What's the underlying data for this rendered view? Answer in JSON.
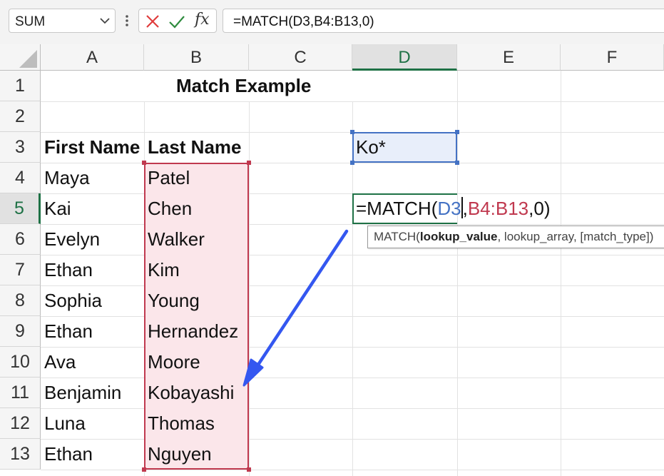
{
  "formula_bar": {
    "name_box": "SUM",
    "fx_label": "fx",
    "formula": "=MATCH(D3,B4:B13,0)"
  },
  "columns": [
    "A",
    "B",
    "C",
    "D",
    "E",
    "F"
  ],
  "rows": [
    "1",
    "2",
    "3",
    "4",
    "5",
    "6",
    "7",
    "8",
    "9",
    "10",
    "11",
    "12",
    "13"
  ],
  "cells": {
    "title": "Match Example",
    "a3": "First Name",
    "b3": "Last Name",
    "d3": "Ko*",
    "first_names": [
      "Maya",
      "Kai",
      "Evelyn",
      "Ethan",
      "Sophia",
      "Ethan",
      "Ava",
      "Benjamin",
      "Luna",
      "Ethan"
    ],
    "last_names": [
      "Patel",
      "Chen",
      "Walker",
      "Kim",
      "Young",
      "Hernandez",
      "Moore",
      "Kobayashi",
      "Thomas",
      "Nguyen"
    ]
  },
  "edit": {
    "prefix": "=MATCH(",
    "arg1": "D3",
    "sep1": ",",
    "arg2": "B4:B13",
    "rest": ",0)"
  },
  "tooltip": {
    "fn": "MATCH(",
    "arg_bold": "lookup_value",
    "rest": ", lookup_array, [match_type])"
  },
  "colors": {
    "ref_blue": "#4472c4",
    "ref_red": "#c0394f",
    "active_green": "#1e7145",
    "arrow_blue": "#3457f0"
  }
}
